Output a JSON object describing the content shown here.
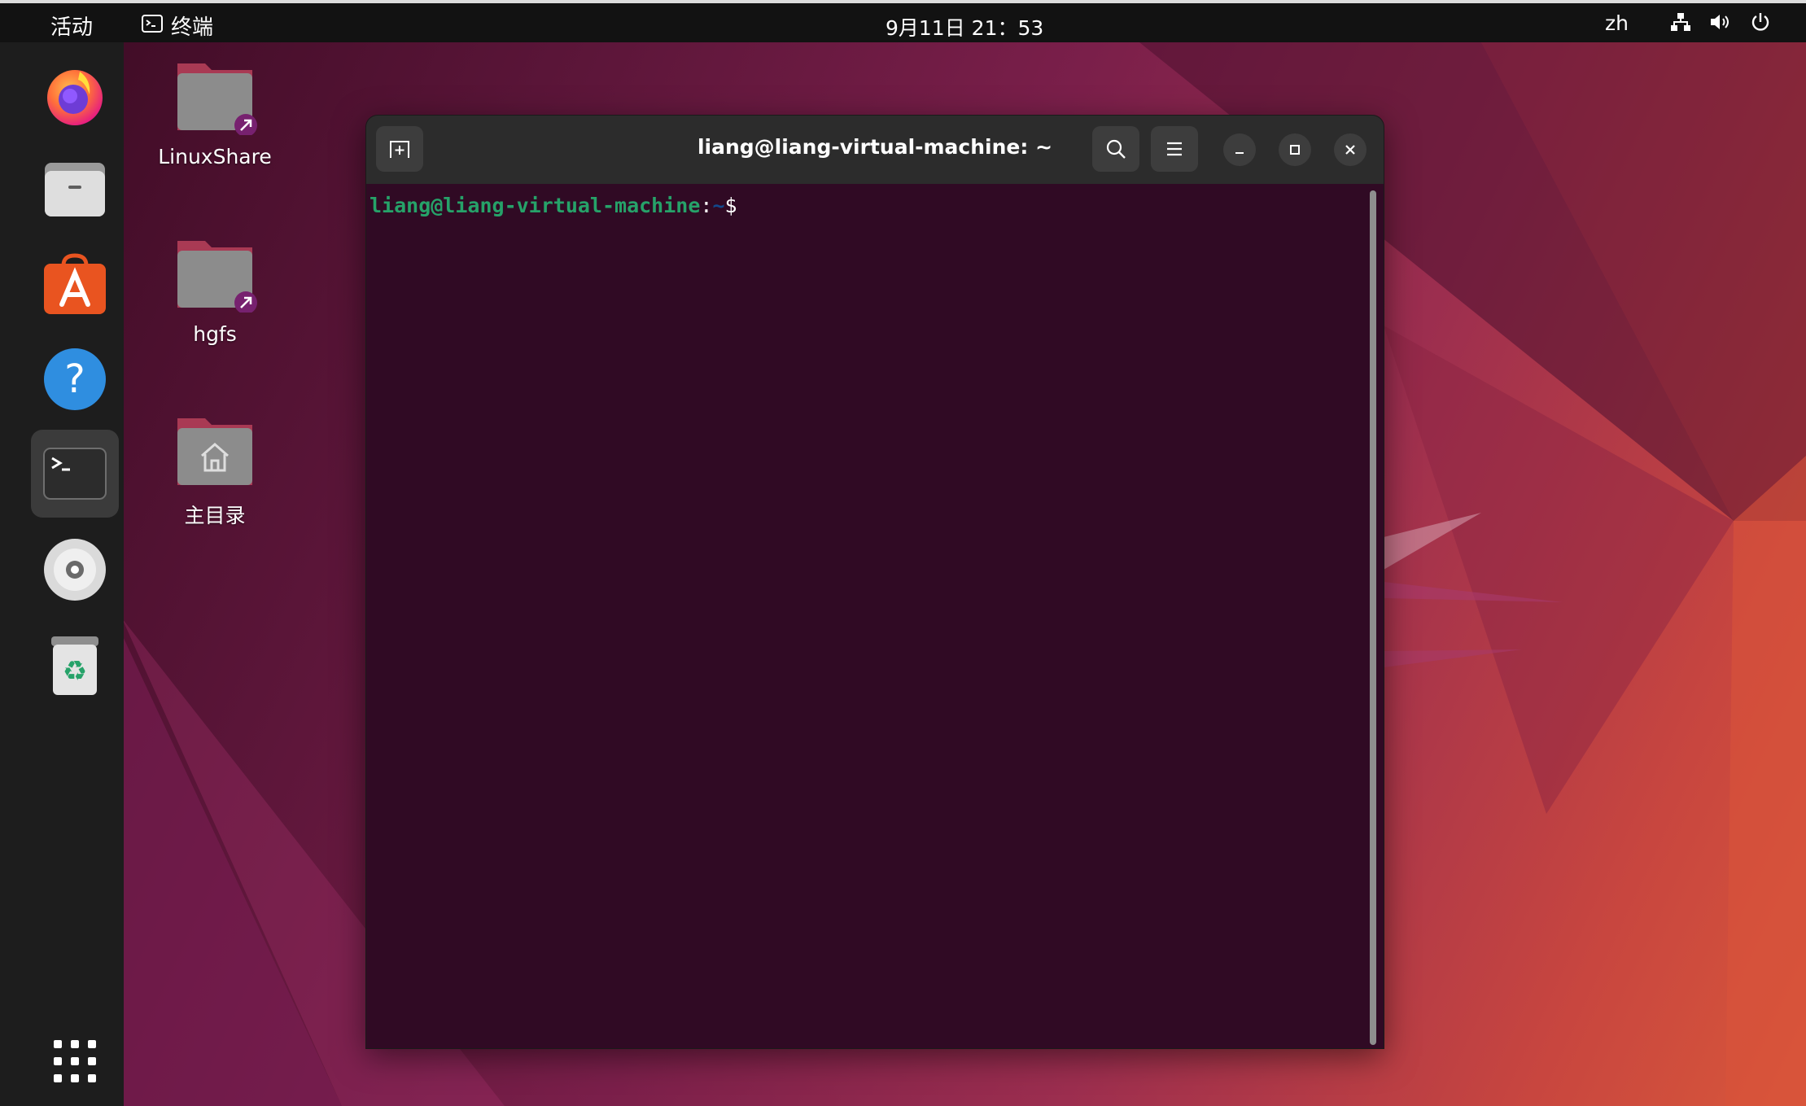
{
  "topbar": {
    "activities": "活动",
    "app_name": "终端",
    "clock": "9月11日  21：53",
    "language": "zh",
    "tray_icons": [
      "network-icon",
      "volume-icon",
      "power-icon"
    ]
  },
  "dock": {
    "items": [
      {
        "name": "Firefox",
        "icon": "firefox-icon"
      },
      {
        "name": "Files",
        "icon": "files-icon"
      },
      {
        "name": "Ubuntu Software",
        "icon": "software-icon"
      },
      {
        "name": "Help",
        "icon": "help-icon"
      },
      {
        "name": "Terminal",
        "icon": "terminal-icon",
        "active": true
      },
      {
        "name": "Disc",
        "icon": "disc-icon"
      },
      {
        "name": "Trash",
        "icon": "trash-icon"
      },
      {
        "name": "Show Applications",
        "icon": "app-grid-icon"
      }
    ]
  },
  "desktop_icons": [
    {
      "label": "LinuxShare",
      "icon": "folder-link-icon"
    },
    {
      "label": "hgfs",
      "icon": "folder-link-icon"
    },
    {
      "label": "主目录",
      "icon": "home-folder-icon"
    }
  ],
  "terminal": {
    "title": "liang@liang-virtual-machine: ~",
    "prompt": {
      "user_host": "liang@liang-virtual-machine",
      "colon": ":",
      "path": "~",
      "symbol": "$"
    }
  },
  "colors": {
    "topbar_bg": "#121212",
    "dock_bg": "#1d1d1d",
    "terminal_bg": "#300a24",
    "terminal_header": "#2c2c2c",
    "prompt_user": "#26a269",
    "prompt_path": "#12488b",
    "accent": "#e95420"
  }
}
